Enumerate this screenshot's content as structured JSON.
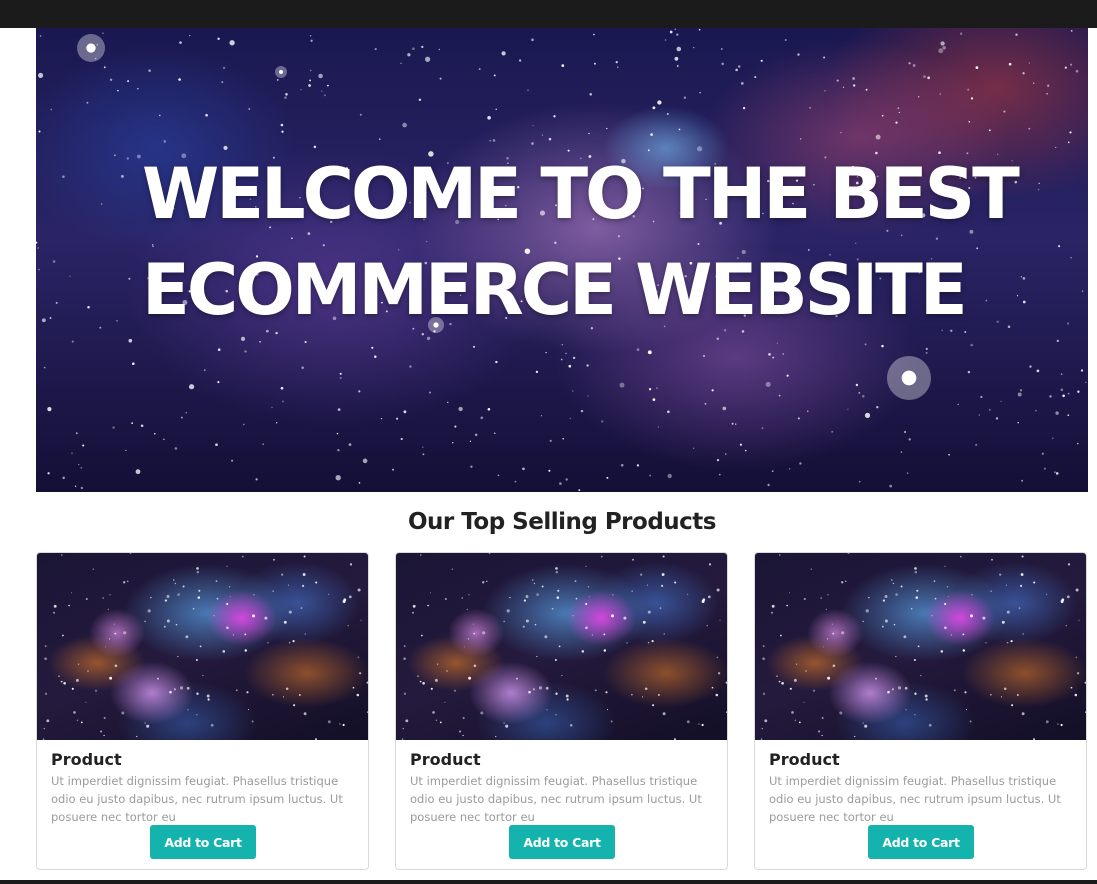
{
  "hero": {
    "title": "WELCOME TO THE BEST ECOMMERCE WEBSITE"
  },
  "section": {
    "title": "Our Top Selling Products"
  },
  "products": [
    {
      "name": "Product",
      "description": "Ut imperdiet dignissim feugiat. Phasellus tristique odio eu justo dapibus, nec rutrum ipsum luctus. Ut posuere nec tortor eu",
      "button_label": "Add to Cart"
    },
    {
      "name": "Product",
      "description": "Ut imperdiet dignissim feugiat. Phasellus tristique odio eu justo dapibus, nec rutrum ipsum luctus. Ut posuere nec tortor eu",
      "button_label": "Add to Cart"
    },
    {
      "name": "Product",
      "description": "Ut imperdiet dignissim feugiat. Phasellus tristique odio eu justo dapibus, nec rutrum ipsum luctus. Ut posuere nec tortor eu",
      "button_label": "Add to Cart"
    }
  ],
  "colors": {
    "top_bar": "#1b1b1b",
    "button": "#14b3ad",
    "heading_text": "#222222",
    "description_text": "#9b9b9b"
  }
}
